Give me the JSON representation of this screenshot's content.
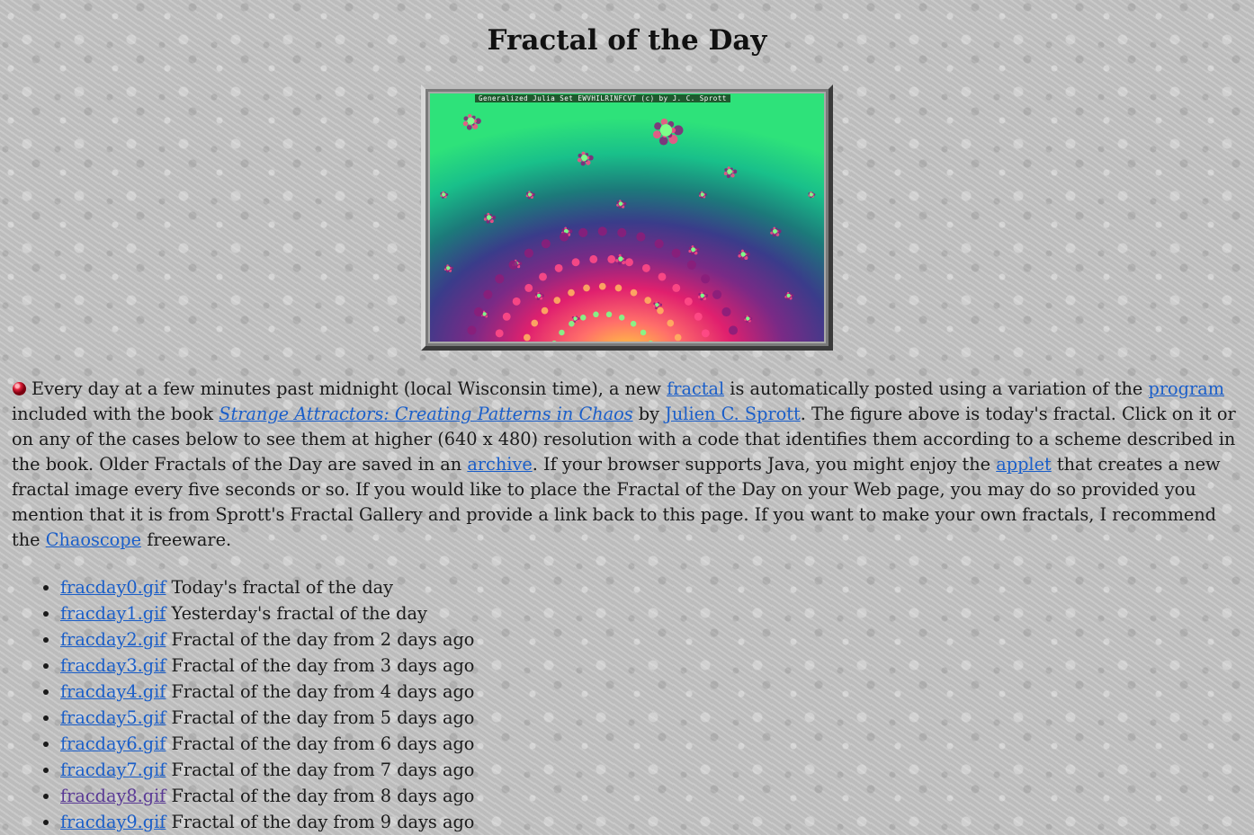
{
  "page": {
    "title": "Fractal of the Day"
  },
  "figure": {
    "caption": "Generalized Julia Set   EWVHILRINFCVT   (c)  by J. C. Sprott"
  },
  "intro": {
    "t1": "Every day at a few minutes past midnight (local Wisconsin time), a new ",
    "link_fractal": "fractal",
    "t2": " is automatically posted using a variation of the ",
    "link_program": "program",
    "t3": " included with the book ",
    "link_book": "Strange Attractors: Creating Patterns in Chaos",
    "t4": " by ",
    "link_author": "Julien C. Sprott",
    "t5": ". The figure above is today's fractal. Click on it or on any of the cases below to see them at higher (640 x 480) resolution with a code that identifies them according to a scheme described in the book. Older Fractals of the Day are saved in an ",
    "link_archive": "archive",
    "t6": ". If your browser supports Java, you might enjoy the ",
    "link_applet": "applet",
    "t7": " that creates a new fractal image every five seconds or so. If you would like to place the Fractal of the Day on your Web page, you may do so provided you mention that it is from Sprott's Fractal Gallery and provide a link back to this page. If you want to make your own fractals, I recommend the ",
    "link_chaoscope": "Chaoscope",
    "t8": " freeware."
  },
  "days": [
    {
      "file": "fracday0.gif",
      "desc": " Today's fractal of the day"
    },
    {
      "file": "fracday1.gif",
      "desc": " Yesterday's fractal of the day"
    },
    {
      "file": "fracday2.gif",
      "desc": " Fractal of the day from 2 days ago"
    },
    {
      "file": "fracday3.gif",
      "desc": " Fractal of the day from 3 days ago"
    },
    {
      "file": "fracday4.gif",
      "desc": " Fractal of the day from 4 days ago"
    },
    {
      "file": "fracday5.gif",
      "desc": " Fractal of the day from 5 days ago"
    },
    {
      "file": "fracday6.gif",
      "desc": " Fractal of the day from 6 days ago"
    },
    {
      "file": "fracday7.gif",
      "desc": " Fractal of the day from 7 days ago"
    },
    {
      "file": "fracday8.gif",
      "desc": " Fractal of the day from 8 days ago"
    },
    {
      "file": "fracday9.gif",
      "desc": " Fractal of the day from 9 days ago"
    }
  ],
  "colors": {
    "link": "#1a5ec9",
    "visited_link": "#5a3a96",
    "bullet": "#e0203a"
  }
}
